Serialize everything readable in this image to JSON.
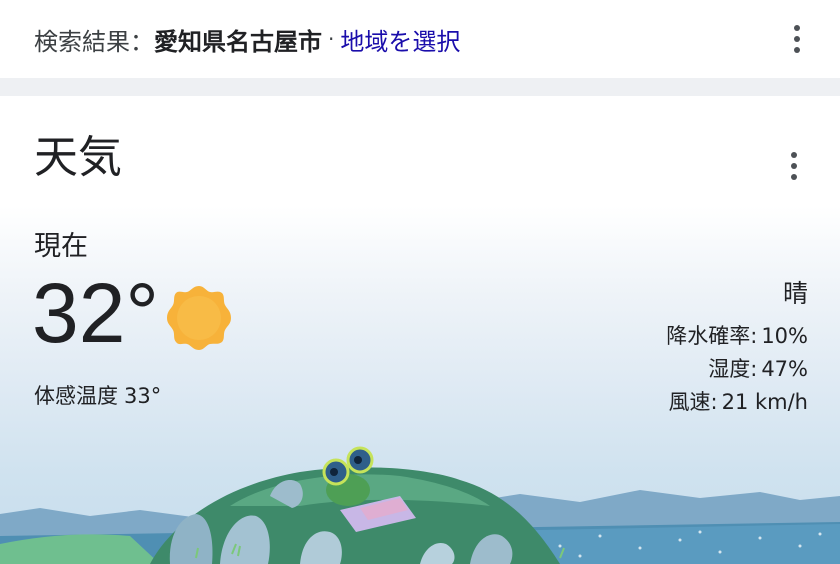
{
  "search_bar": {
    "prefix": "検索結果：",
    "location": "愛知県名古屋市",
    "separator": "·",
    "select_region": "地域を選択"
  },
  "weather": {
    "title": "天気",
    "now_label": "現在",
    "temperature": "32°",
    "condition_icon": "sun-icon",
    "feels_like_label": "体感温度",
    "feels_like_value": "33°",
    "condition": "晴",
    "precip_label": "降水確率:",
    "precip_value": "10%",
    "humidity_label": "湿度:",
    "humidity_value": "47%",
    "wind_label": "風速:",
    "wind_value": "21 km/h"
  },
  "colors": {
    "link": "#1a0dab",
    "sun": "#f7b23a",
    "sky": "#c5dcec",
    "hill": "#3e8a6a",
    "sea": "#4f8fb3"
  }
}
